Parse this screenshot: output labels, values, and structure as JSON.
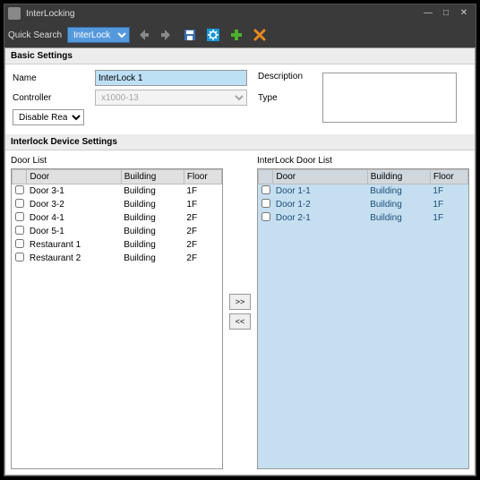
{
  "window": {
    "title": "InterLocking"
  },
  "toolbar": {
    "quick_search_label": "Quick Search",
    "quick_search_value": "InterLock 1"
  },
  "sections": {
    "basic": "Basic Settings",
    "device": "Interlock Device Settings"
  },
  "fields": {
    "name_label": "Name",
    "name_value": "InterLock 1",
    "controller_label": "Controller",
    "controller_value": "x1000-13",
    "type_label": "Type",
    "type_value": "Disable Reader",
    "description_label": "Description",
    "description_value": ""
  },
  "lists": {
    "left_title": "Door List",
    "right_title": "InterLock Door List",
    "columns": {
      "door": "Door",
      "building": "Building",
      "floor": "Floor"
    },
    "move_right": ">>",
    "move_left": "<<",
    "left": [
      {
        "door": "Door 3-1",
        "building": "Building",
        "floor": "1F"
      },
      {
        "door": "Door 3-2",
        "building": "Building",
        "floor": "1F"
      },
      {
        "door": "Door 4-1",
        "building": "Building",
        "floor": "2F"
      },
      {
        "door": "Door 5-1",
        "building": "Building",
        "floor": "2F"
      },
      {
        "door": "Restaurant 1",
        "building": "Building",
        "floor": "2F"
      },
      {
        "door": "Restaurant 2",
        "building": "Building",
        "floor": "2F"
      }
    ],
    "right": [
      {
        "door": "Door 1-1",
        "building": "Building",
        "floor": "1F"
      },
      {
        "door": "Door 1-2",
        "building": "Building",
        "floor": "1F"
      },
      {
        "door": "Door 2-1",
        "building": "Building",
        "floor": "1F"
      }
    ]
  }
}
